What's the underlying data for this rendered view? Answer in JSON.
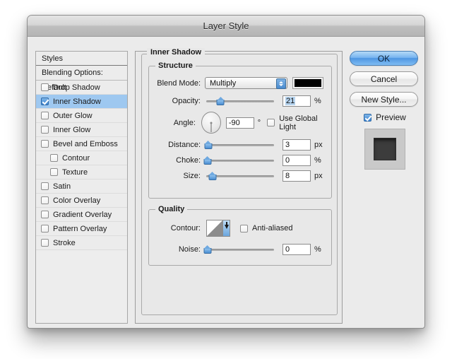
{
  "window": {
    "title": "Layer Style"
  },
  "sidebar": {
    "header": "Styles",
    "blending_options": "Blending Options: Default",
    "items": [
      {
        "label": "Drop Shadow",
        "checked": false,
        "selected": false,
        "indent": false
      },
      {
        "label": "Inner Shadow",
        "checked": true,
        "selected": true,
        "indent": false
      },
      {
        "label": "Outer Glow",
        "checked": false,
        "selected": false,
        "indent": false
      },
      {
        "label": "Inner Glow",
        "checked": false,
        "selected": false,
        "indent": false
      },
      {
        "label": "Bevel and Emboss",
        "checked": false,
        "selected": false,
        "indent": false
      },
      {
        "label": "Contour",
        "checked": false,
        "selected": false,
        "indent": true
      },
      {
        "label": "Texture",
        "checked": false,
        "selected": false,
        "indent": true
      },
      {
        "label": "Satin",
        "checked": false,
        "selected": false,
        "indent": false
      },
      {
        "label": "Color Overlay",
        "checked": false,
        "selected": false,
        "indent": false
      },
      {
        "label": "Gradient Overlay",
        "checked": false,
        "selected": false,
        "indent": false
      },
      {
        "label": "Pattern Overlay",
        "checked": false,
        "selected": false,
        "indent": false
      },
      {
        "label": "Stroke",
        "checked": false,
        "selected": false,
        "indent": false
      }
    ]
  },
  "panel": {
    "title": "Inner Shadow",
    "structure": {
      "legend": "Structure",
      "blend_mode_label": "Blend Mode:",
      "blend_mode_value": "Multiply",
      "shadow_color": "#000000",
      "opacity_label": "Opacity:",
      "opacity_value": "21",
      "opacity_unit": "%",
      "angle_label": "Angle:",
      "angle_value": "-90",
      "angle_unit": "°",
      "use_global_light_label": "Use Global Light",
      "use_global_light_checked": false,
      "distance_label": "Distance:",
      "distance_value": "3",
      "distance_unit": "px",
      "choke_label": "Choke:",
      "choke_value": "0",
      "choke_unit": "%",
      "size_label": "Size:",
      "size_value": "8",
      "size_unit": "px"
    },
    "quality": {
      "legend": "Quality",
      "contour_label": "Contour:",
      "anti_aliased_label": "Anti-aliased",
      "anti_aliased_checked": false,
      "noise_label": "Noise:",
      "noise_value": "0",
      "noise_unit": "%"
    }
  },
  "buttons": {
    "ok": "OK",
    "cancel": "Cancel",
    "new_style": "New Style...",
    "preview_label": "Preview",
    "preview_checked": true
  },
  "colors": {
    "accent_blue": "#4a8ed3",
    "selection_blue": "#9ec8f0",
    "dialog_bg": "#ebebeb",
    "panel_bg": "#e8e8e8"
  }
}
